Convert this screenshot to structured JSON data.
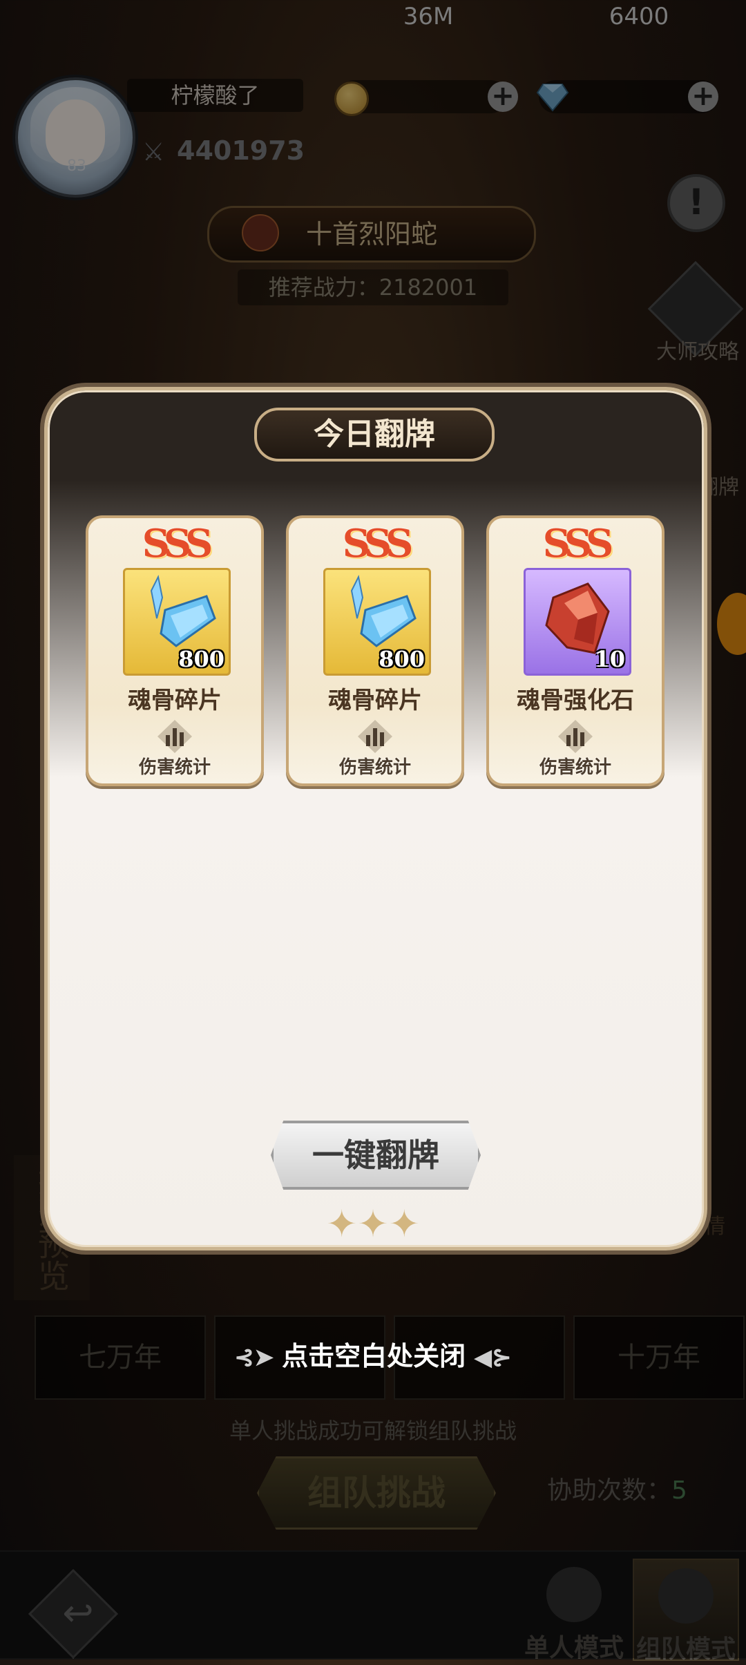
{
  "player": {
    "name": "柠檬酸了",
    "level": "83",
    "coins": "36M",
    "gems": "6400",
    "power": "4401973"
  },
  "boss": {
    "name": "十首烈阳蛇",
    "recommend": "推荐战力：2182001"
  },
  "side": {
    "guide_label": "大师攻略",
    "flip_label": "翻牌"
  },
  "modal": {
    "title": "今日翻牌",
    "cards": [
      {
        "rank": "SSS",
        "item_name": "魂骨碎片",
        "count": "800",
        "stat_label": "伤害统计",
        "item_icon": "crystal-icon"
      },
      {
        "rank": "SSS",
        "item_name": "魂骨碎片",
        "count": "800",
        "stat_label": "伤害统计",
        "item_icon": "crystal-icon"
      },
      {
        "rank": "SSS",
        "item_name": "魂骨强化石",
        "count": "10",
        "stat_label": "伤害统计",
        "item_icon": "red-stone-icon"
      }
    ],
    "flip_all_label": "一键翻牌"
  },
  "close_hint": "点击空白处关闭",
  "background": {
    "preview_label": "掉落预览",
    "detail_label": "掉落详情",
    "tiers": [
      "七万年",
      "十万年"
    ],
    "unlock_hint": "单人挑战成功可解锁组队挑战",
    "team_challenge": "组队挑战",
    "assist_label": "协助次数：",
    "assist_count": "5",
    "modes": [
      "单人模式",
      "组队模式"
    ]
  },
  "colors": {
    "accent_gold": "#c8ae86",
    "rank_red": "#e54d2a",
    "assist_count": "#4a7a52"
  }
}
